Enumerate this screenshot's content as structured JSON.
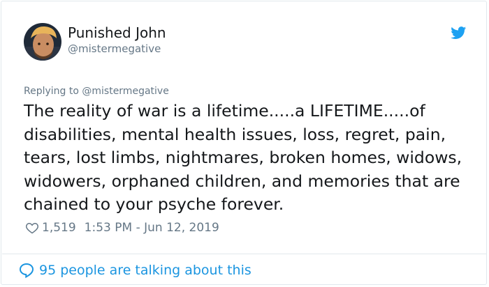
{
  "author": {
    "display_name": "Punished John",
    "handle": "@mistermegative",
    "avatar_icon": "user-avatar"
  },
  "brand": {
    "icon": "twitter-bird-icon",
    "color": "#1da1f2"
  },
  "reply_context": {
    "label": "Replying to @mistermegative"
  },
  "tweet": {
    "text": "The reality of war is a lifetime.....a LIFETIME.....of disabilities, mental health issues, loss, regret, pain, tears, lost limbs, nightmares, broken homes, widows, widowers, orphaned children, and memories that are chained to your psyche forever."
  },
  "meta": {
    "like_icon": "heart-icon",
    "like_count": "1,519",
    "timestamp": "1:53 PM - Jun 12, 2019"
  },
  "footer": {
    "icon": "speech-bubble-icon",
    "talking_label": "95 people are talking about this",
    "link_color": "#1b95e0"
  }
}
